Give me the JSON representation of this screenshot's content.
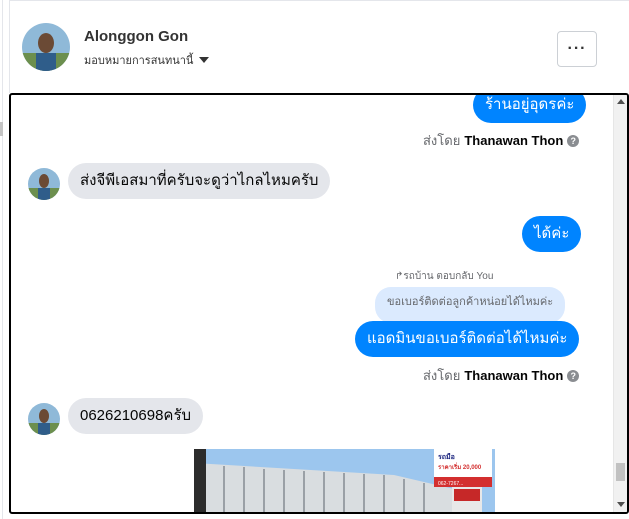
{
  "header": {
    "name": "Alonggon Gon",
    "status": "มอบหมายการสนทนานี้",
    "more_label": "···"
  },
  "messages": [
    {
      "type": "out",
      "text": "ร้านอยู่อุดรค่ะ"
    },
    {
      "type": "sent_by",
      "prefix": "ส่งโดย",
      "author": "Thanawan Thon"
    },
    {
      "type": "in",
      "text": "ส่งจีพีเอสมาที่ครับจะดูว่าไกลไหมครับ"
    },
    {
      "type": "out",
      "text": "ได้ค่ะ"
    },
    {
      "type": "reply_note",
      "text": "รถบ้าน ตอบกลับ You"
    },
    {
      "type": "quoted",
      "text": "ขอเบอร์ติดต่อลูกค้าหน่อยได้ไหมค่ะ"
    },
    {
      "type": "out",
      "text": "แอดมินขอเบอร์ติดต่อได้ไหมค่ะ"
    },
    {
      "type": "sent_by",
      "prefix": "ส่งโดย",
      "author": "Thanawan Thon"
    },
    {
      "type": "in",
      "text": "0626210698ครับ"
    }
  ],
  "photo_sign": {
    "lines": [
      "รถมือ",
      "ราคาเริ่ม 20,000",
      "062-7267..."
    ]
  },
  "help_glyph": "?",
  "colors": {
    "outgoing": "#0084ff",
    "incoming": "#e4e6eb",
    "quoted": "#dbeafe"
  }
}
